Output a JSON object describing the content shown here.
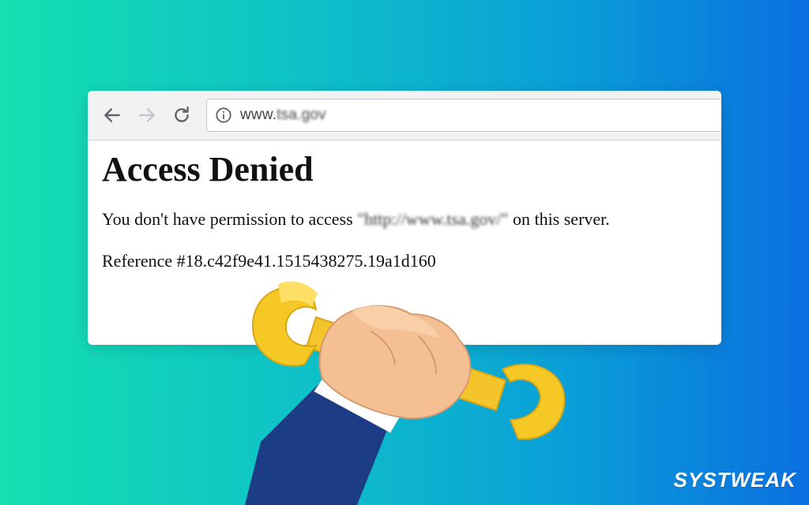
{
  "browser": {
    "address": {
      "url_prefix": "www.",
      "url_host": "tsa.gov"
    }
  },
  "page": {
    "title": "Access Denied",
    "message_before": "You don't have permission to access ",
    "message_url": "\"http://www.tsa.gov/\"",
    "message_after": " on this server.",
    "reference": "Reference #18.c42f9e41.1515438275.19a1d160"
  },
  "branding": {
    "logo_text": "SYSTWEAK"
  },
  "icons": {
    "back": "arrow-left-icon",
    "forward": "arrow-right-icon",
    "reload": "reload-icon",
    "info": "info-icon",
    "illustration": "hand-holding-wrench-icon"
  },
  "colors": {
    "background_start": "#14e0b0",
    "background_end": "#0a6fe0",
    "wrench": "#f3c52a",
    "sleeve": "#1d3c86"
  }
}
